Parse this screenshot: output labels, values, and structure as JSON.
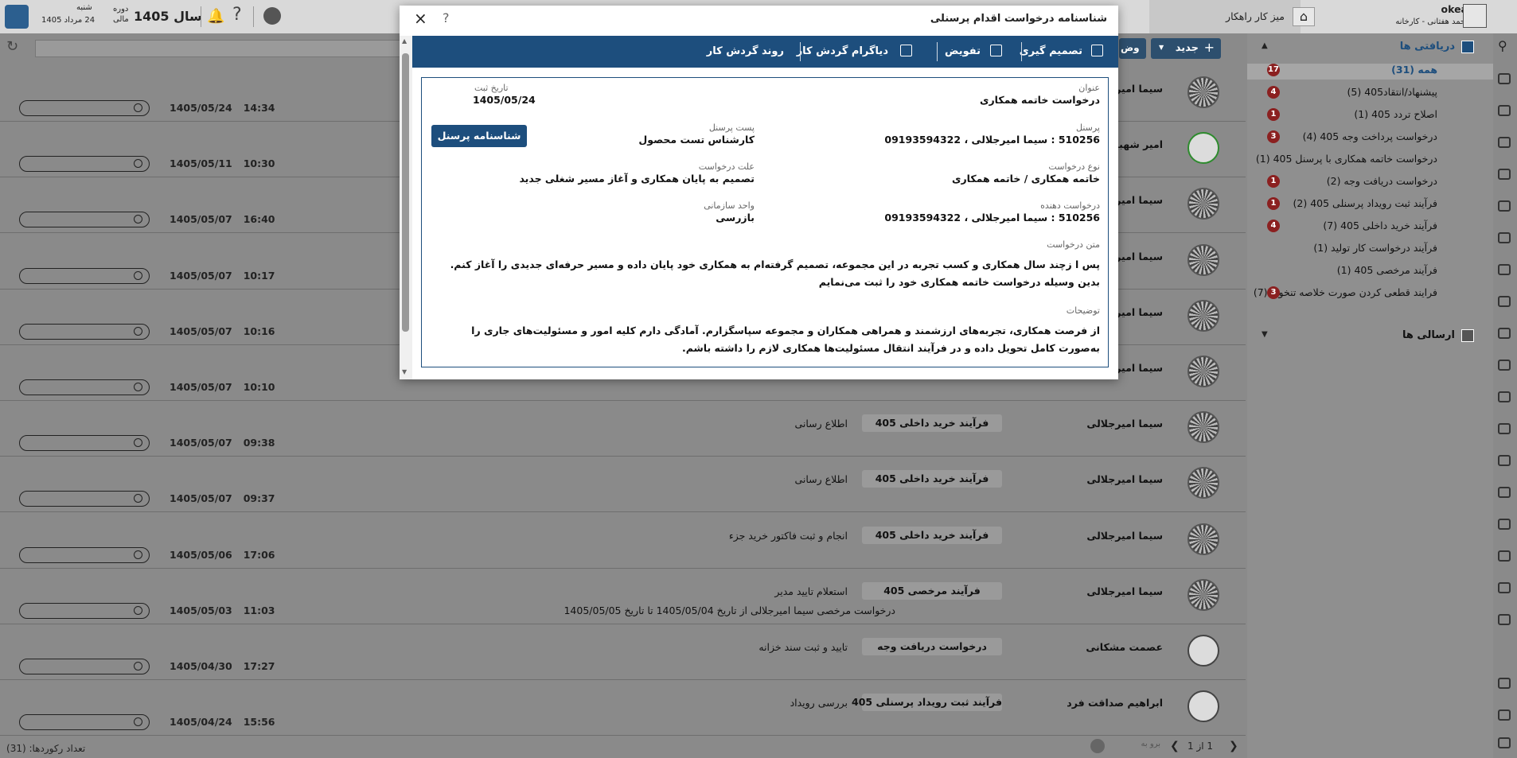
{
  "topbar": {
    "day": "شنبه",
    "date": "24 مرداد 1405",
    "period_label": "دوره",
    "period_sub": "مالی",
    "year": "سال 1405",
    "tab_cartable": "میز کار راهکار",
    "user_name": "okea",
    "user_role": "احمد هفتانی - کارخانه"
  },
  "sidebar": {
    "inbox_title": "دریافتی ها",
    "outbox_title": "ارسالی ها",
    "items": [
      {
        "label": "همه (31)",
        "badge": "17"
      },
      {
        "label": "پیشنهاد/انتقاد405 (5)",
        "badge": "4"
      },
      {
        "label": "اصلاح تردد 405 (1)",
        "badge": "1"
      },
      {
        "label": "درخواست پرداخت وجه 405 (4)",
        "badge": "3"
      },
      {
        "label": "درخواست خاتمه همکاری با پرسنل 405 (1)",
        "badge": ""
      },
      {
        "label": "درخواست دریافت وجه (2)",
        "badge": "1"
      },
      {
        "label": "فرآیند ثبت رویداد پرسنلی 405 (2)",
        "badge": "1"
      },
      {
        "label": "فرآیند خرید داخلی 405 (7)",
        "badge": "4"
      },
      {
        "label": "فرآیند درخواست کار تولید (1)",
        "badge": ""
      },
      {
        "label": "فرآیند مرخصی 405 (1)",
        "badge": ""
      },
      {
        "label": "فرایند قطعی کردن صورت خلاصه تنخواه (7)",
        "badge": "3"
      }
    ]
  },
  "toolbar": {
    "new_label": "جدید",
    "state_label": "وض"
  },
  "rows": [
    {
      "date": "1405/05/24",
      "time": "14:34",
      "name": "سیما امیرجلا",
      "process": "",
      "action": "",
      "desc": "",
      "avatar": "qr"
    },
    {
      "date": "1405/05/11",
      "time": "10:30",
      "name": "امیر شهبازی",
      "process": "",
      "action": "",
      "desc": "",
      "avatar": "person-green"
    },
    {
      "date": "1405/05/07",
      "time": "16:40",
      "name": "سیما امیرجلا",
      "process": "",
      "action": "",
      "desc": "",
      "avatar": "qr"
    },
    {
      "date": "1405/05/07",
      "time": "10:17",
      "name": "سیما امیرجلا",
      "process": "",
      "action": "",
      "desc": "",
      "avatar": "qr"
    },
    {
      "date": "1405/05/07",
      "time": "10:16",
      "name": "سیما امیرجلا",
      "process": "",
      "action": "",
      "desc": "",
      "avatar": "qr"
    },
    {
      "date": "1405/05/07",
      "time": "10:10",
      "name": "سیما امیرجلا",
      "process": "",
      "action": "",
      "desc": "",
      "avatar": "qr"
    },
    {
      "date": "1405/05/07",
      "time": "09:38",
      "name": "سیما امیرجلالی",
      "process": "فرآیند خرید داخلی 405",
      "action": "اطلاع رسانی",
      "desc": "",
      "avatar": "qr"
    },
    {
      "date": "1405/05/07",
      "time": "09:37",
      "name": "سیما امیرجلالی",
      "process": "فرآیند خرید داخلی 405",
      "action": "اطلاع رسانی",
      "desc": "",
      "avatar": "qr"
    },
    {
      "date": "1405/05/06",
      "time": "17:06",
      "name": "سیما امیرجلالی",
      "process": "فرآیند خرید داخلی 405",
      "action": "انجام و ثبت فاکتور خرید جزء",
      "desc": "",
      "avatar": "qr"
    },
    {
      "date": "1405/05/03",
      "time": "11:03",
      "name": "سیما امیرجلالی",
      "process": "فرآیند مرخصی 405",
      "action": "استعلام تایید مدیر",
      "desc": "درخواست مرخصی سیما امیرجلالی از تاریخ 1405/05/04 تا تاریخ 1405/05/05",
      "avatar": "qr"
    },
    {
      "date": "1405/04/30",
      "time": "17:27",
      "name": "عصمت مشکانی",
      "process": "درخواست دریافت وجه",
      "action": "تایید و ثبت سند خزانه",
      "desc": "",
      "avatar": "person"
    },
    {
      "date": "1405/04/24",
      "time": "15:56",
      "name": "ابراهیم صداقت فرد",
      "process": "فرآیند ثبت رویداد پرسنلی 405",
      "action": "بررسی رویداد",
      "desc": "",
      "avatar": "photo"
    }
  ],
  "footer": {
    "record_count": "تعداد رکوردها: (31)",
    "pager": "1 از 1",
    "goto": "برو به"
  },
  "modal": {
    "title": "شناسنامه درخواست اقدام پرسنلی",
    "help": "?",
    "close": "×",
    "toolbar": {
      "decision": "تصمیم گیری",
      "delegate": "تفویض",
      "workflow_diagram": "دیاگرام گردش کار",
      "workflow_process": "روند گردش کار"
    },
    "fields": {
      "title_label": "عنوان",
      "title_value": "درخواست خاتمه همکاری",
      "reg_date_label": "تاریخ ثبت",
      "reg_date_value": "1405/05/24",
      "personnel_label": "پرسنل",
      "personnel_value": "510256 : سیما امیرجلالی ، 09193594322",
      "post_label": "پست پرسنل",
      "post_value": "کارشناس تست محصول",
      "profile_button": "شناسنامه پرسنل",
      "type_label": "نوع درخواست",
      "type_value": "خاتمه همکاری / خاتمه همکاری",
      "reason_label": "علت درخواست",
      "reason_value": "تصمیم به پایان همکاری و آغاز مسیر شغلی جدید",
      "requester_label": "درخواست دهنده",
      "requester_value": "510256 : سیما امیرجلالی ، 09193594322",
      "unit_label": "واحد سازمانی",
      "unit_value": "بازرسی",
      "text_label": "متن درخواست",
      "text_value": "پس ا زچند سال همکاری و کسب تجربه در این مجموعه، تصمیم گرفته‌ام به همکاری خود پایان داده و مسیر حرفه‌ای جدیدی را آغاز کنم. بدین وسیله درخواست خاتمه همکاری خود را ثبت می‌نمایم",
      "notes_label": "توضیحات",
      "notes_value": "از فرصت همکاری، تجربه‌های ارزشمند و همراهی همکاران و مجموعه سپاسگزارم. آمادگی دارم کلیه امور و مسئولیت‌های جاری را به‌صورت کامل تحویل داده و در فرآیند انتقال مسئولیت‌ها همکاری لازم را داشته باشم."
    }
  }
}
